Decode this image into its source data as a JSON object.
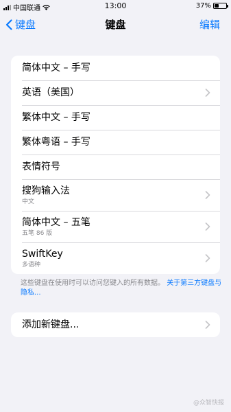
{
  "status_bar": {
    "carrier": "中国联通",
    "time": "13:00",
    "battery_text": "37%",
    "battery_level": 0.37
  },
  "nav": {
    "back_label": "键盘",
    "title": "键盘",
    "edit_label": "编辑"
  },
  "keyboards": [
    {
      "label": "简体中文 – 手写",
      "sub": "",
      "chevron": false
    },
    {
      "label": "英语（美国）",
      "sub": "",
      "chevron": true
    },
    {
      "label": "繁体中文 – 手写",
      "sub": "",
      "chevron": false
    },
    {
      "label": "繁体粤语 – 手写",
      "sub": "",
      "chevron": false
    },
    {
      "label": "表情符号",
      "sub": "",
      "chevron": false
    },
    {
      "label": "搜狗输入法",
      "sub": "中文",
      "chevron": true
    },
    {
      "label": "简体中文 – 五笔",
      "sub": "五笔 86 版",
      "chevron": true
    },
    {
      "label": "SwiftKey",
      "sub": "多语种",
      "chevron": true
    }
  ],
  "footer": {
    "note": "这些键盘在使用时可以访问您键入的所有数据。",
    "link": "关于第三方键盘与隐私..."
  },
  "add_keyboard": {
    "label": "添加新键盘..."
  },
  "watermark": "@众智快报",
  "colors": {
    "accent": "#0a7aff",
    "background": "#f2f2f7",
    "card": "#ffffff",
    "secondary_text": "#8a8a8e"
  }
}
